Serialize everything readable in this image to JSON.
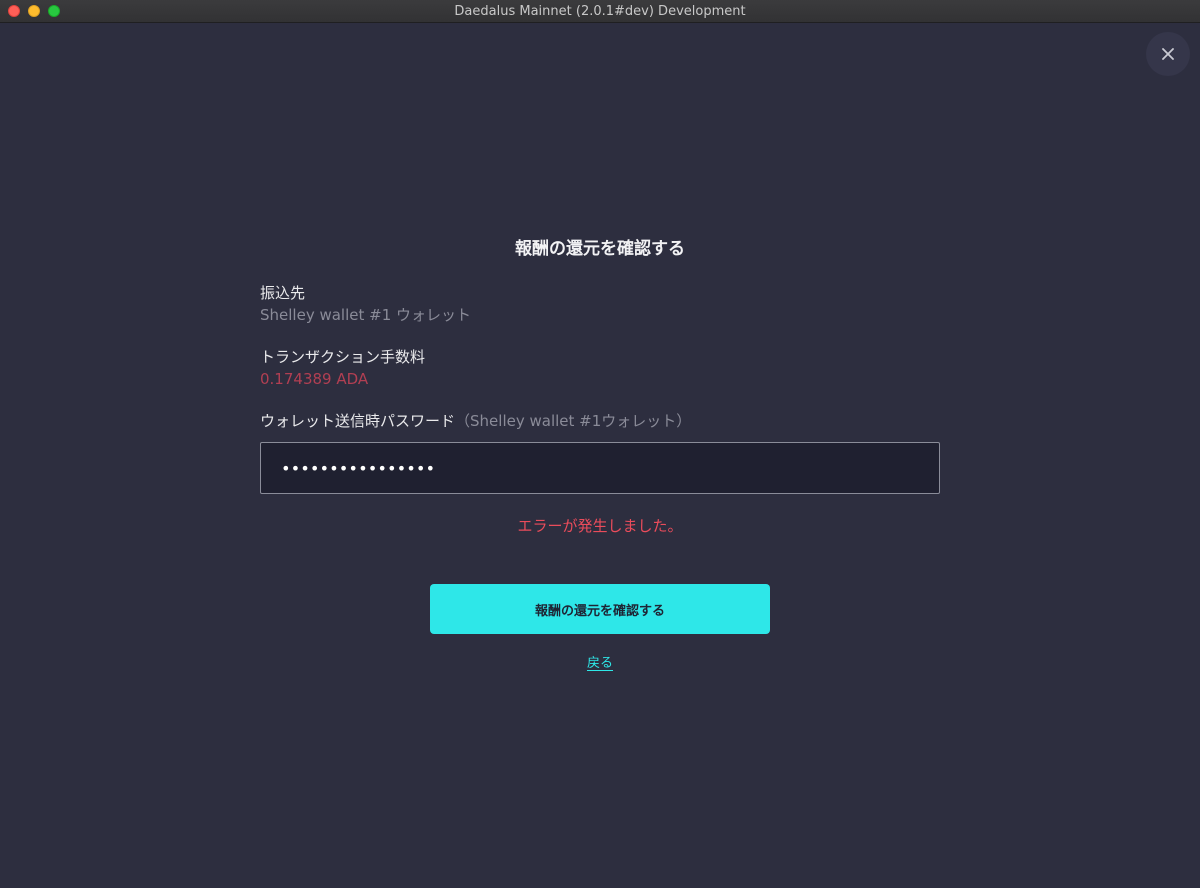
{
  "window": {
    "title": "Daedalus Mainnet (2.0.1#dev) Development"
  },
  "dialog": {
    "title": "報酬の還元を確認する",
    "destination_label": "振込先",
    "destination_value": "Shelley wallet #1 ウォレット",
    "fee_label": "トランザクション手数料",
    "fee_value": "0.174389 ADA",
    "password_label": "ウォレット送信時パスワード",
    "password_hint": "（Shelley wallet #1ウォレット）",
    "password_value": "••••••••••••••••",
    "error_message": "エラーが発生しました。",
    "confirm_button": "報酬の還元を確認する",
    "back_link": "戻る"
  },
  "colors": {
    "background": "#2d2e3f",
    "accent": "#2ee7e8",
    "error": "#ea4c5b",
    "fee": "#b13f52"
  },
  "icons": {
    "close": "close-icon"
  }
}
